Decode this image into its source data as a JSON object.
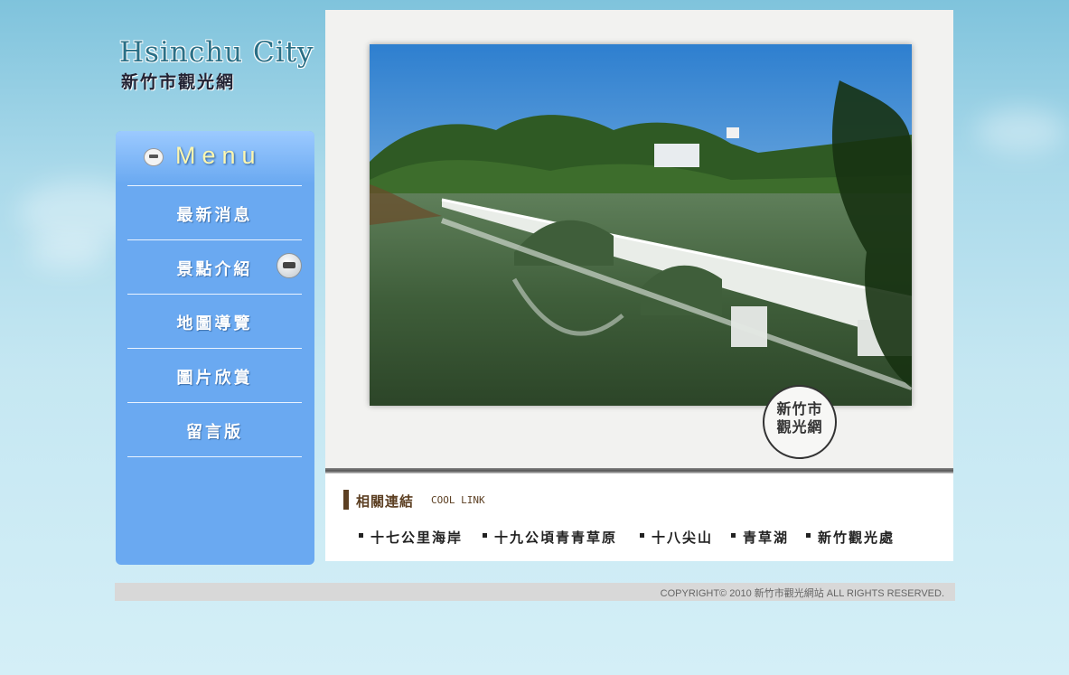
{
  "logo": {
    "en": "Hsinchu City",
    "zh": "新竹市觀光網"
  },
  "menu": {
    "title": "Menu",
    "items": [
      {
        "label": "最新消息"
      },
      {
        "label": "景點介紹"
      },
      {
        "label": "地圖導覽"
      },
      {
        "label": "圖片欣賞"
      },
      {
        "label": "留言版"
      }
    ]
  },
  "stamp": {
    "line1": "新竹市",
    "line2": "觀光網"
  },
  "links": {
    "title": "相關連結",
    "subtitle": "COOL LINK",
    "items": [
      "十七公里海岸",
      "十九公頃青青草原",
      "十八尖山",
      "青草湖",
      "新竹觀光處"
    ]
  },
  "footer": {
    "copyright": "COPYRIGHT© 2010 新竹市觀光網站 ALL RIGHTS RESERVED."
  }
}
